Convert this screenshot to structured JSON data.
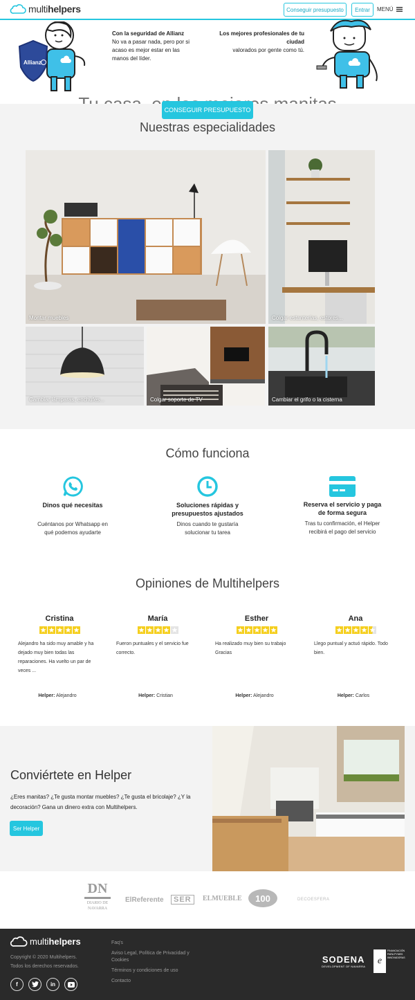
{
  "header": {
    "logo_light": "multi",
    "logo_bold": "helpers",
    "quote_button": "Conseguir presupuesto",
    "login_button": "Entrar",
    "menu_label": "MENÚ"
  },
  "hero": {
    "left_heading": "Con la seguridad de Allianz",
    "left_text": "No va a pasar nada, pero por si acaso es mejor estar en las manos del líder.",
    "right_heading": "Los mejores profesionales de tu ciudad",
    "right_text": "valorados por gente como tú.",
    "badge_text": "Allianz",
    "title": "Tu casa, en las mejores manitas",
    "cta": "CONSEGUIR PRESUPUESTO"
  },
  "specialties": {
    "title": "Nuestras especialidades",
    "tiles": [
      {
        "label": "Montar muebles"
      },
      {
        "label": "Colgar estanterías, estores..."
      },
      {
        "label": "Cambiar lámparas, enchufes..."
      },
      {
        "label": "Colgar soporte de TV"
      },
      {
        "label": "Cambiar el grifo o la cisterna"
      }
    ]
  },
  "how": {
    "title": "Cómo funciona",
    "steps": [
      {
        "icon": "whatsapp-icon",
        "title": "Dinos qué necesitas",
        "desc": "Cuéntanos por Whatsapp en qué podemos ayudarte"
      },
      {
        "icon": "clock-icon",
        "title": "Soluciones rápidas y presupuestos ajustados",
        "desc": "Dinos cuando te gustaría solucionar tu tarea"
      },
      {
        "icon": "credit-card-icon",
        "title": "Reserva el servicio y paga de forma segura",
        "desc": "Tras tu confirmación, el Helper recibirá el pago del servicio"
      }
    ]
  },
  "reviews": {
    "title": "Opiniones de Multihelpers",
    "helper_prefix": "Helper:",
    "items": [
      {
        "name": "Cristina",
        "rating": 5,
        "text": "Alejandro ha sido muy amable y ha dejado muy bien todas las reparaciones. Ha vuelto un par de veces ...",
        "helper": "Alejandro"
      },
      {
        "name": "María",
        "rating": 4,
        "text": "Fueron puntuales y el servicio fue correcto.",
        "helper": "Cristian"
      },
      {
        "name": "Esther",
        "rating": 5,
        "text": "Ha realizado muy bien su trabajo Gracias",
        "helper": "Alejandro"
      },
      {
        "name": "Ana",
        "rating": 4.5,
        "text": "Llego puntual y actuó rápido. Todo bien.",
        "helper": "Carlos"
      }
    ]
  },
  "become": {
    "title": "Conviértete en Helper",
    "text": "¿Eres manitas? ¿Te gusta montar muebles? ¿Te gusta el bricolaje? ¿Y la decoración? Gana un dinero extra con Multihelpers.",
    "button": "Ser Helper"
  },
  "press": {
    "dn": "DN",
    "dn_sub": "DIARIO DE NAVARRA",
    "referente": "ElReferente",
    "ser": "SER",
    "mueble": "ELMUEBLE",
    "cien": "100",
    "decoesfera": "DECOESFERA"
  },
  "footer": {
    "logo_light": "multi",
    "logo_bold": "helpers",
    "copyright": "Copyright © 2020 Multihelpers.",
    "rights": "Todos los derechos reservados.",
    "links": [
      "Faq's",
      "Aviso Legal, Política de Privacidad y Cookies",
      "Términos y condiciones de uso",
      "Contacto"
    ],
    "sodena": "SODENA",
    "sodena_sub": "DEVELOPMENT OF NAVARRA",
    "enisa_text": "FINANCIACIÓN PARA PYMES INNOVADORAS"
  },
  "colors": {
    "accent": "#25c6df",
    "star": "#f5cf1f",
    "footer_bg": "#2a2a2a",
    "section_bg": "#f3f3f3"
  }
}
